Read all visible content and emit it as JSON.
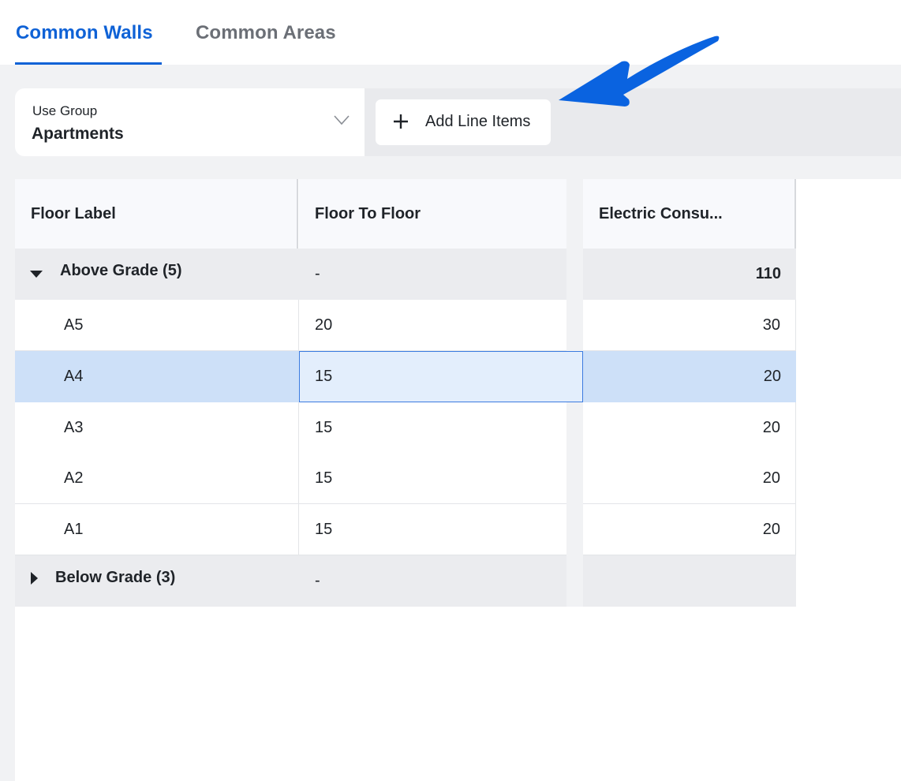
{
  "tabs": [
    {
      "label": "Common Walls",
      "active": true
    },
    {
      "label": "Common Areas",
      "active": false
    }
  ],
  "use_group": {
    "label": "Use Group",
    "value": "Apartments"
  },
  "toolbar": {
    "add_line_items_label": "Add Line Items"
  },
  "table": {
    "columns": [
      "Floor Label",
      "Floor To Floor",
      "Electric Consu..."
    ],
    "groups": [
      {
        "label": "Above Grade (5)",
        "expanded": true,
        "floor_to_floor": "-",
        "electric": "110",
        "rows": [
          {
            "floor_label": "A5",
            "floor_to_floor": "20",
            "electric": "30",
            "selected": false
          },
          {
            "floor_label": "A4",
            "floor_to_floor": "15",
            "electric": "20",
            "selected": true
          },
          {
            "floor_label": "A3",
            "floor_to_floor": "15",
            "electric": "20",
            "selected": false
          },
          {
            "floor_label": "A2",
            "floor_to_floor": "15",
            "electric": "20",
            "selected": false
          },
          {
            "floor_label": "A1",
            "floor_to_floor": "15",
            "electric": "20",
            "selected": false
          }
        ]
      },
      {
        "label": "Below Grade (3)",
        "expanded": false,
        "floor_to_floor": "-",
        "electric": ""
      }
    ]
  },
  "colors": {
    "accent": "#0f62d6",
    "annotation_arrow": "#0a63e0",
    "selected_row": "#cde0f8",
    "group_row": "#ebecef"
  },
  "icons": {
    "chevron": "chevron-down-icon",
    "add": "plus-icon",
    "expand": "caret-down-icon",
    "collapse": "caret-right-icon",
    "annotation": "arrow-annotation-icon"
  }
}
